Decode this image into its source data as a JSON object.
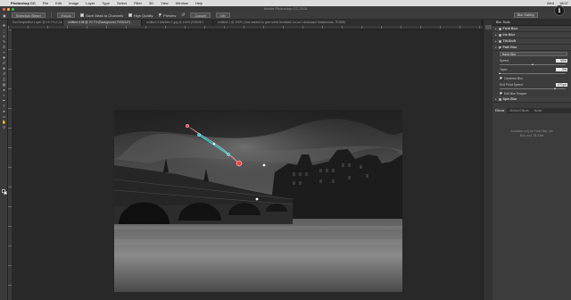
{
  "menubar": {
    "items": [
      "Photoshop CC",
      "File",
      "Edit",
      "Image",
      "Layer",
      "Type",
      "Select",
      "Filter",
      "3D",
      "View",
      "Window",
      "Help"
    ],
    "right": [
      "Wed",
      "18:07"
    ]
  },
  "titlebar": {
    "title": "Adobe Photoshop CC 2015"
  },
  "options": {
    "preset": "Selection Bleed",
    "focus": "Focus",
    "save_mask": "Save Mask to Channels",
    "high_quality": "High Quality",
    "preview": "Preview",
    "cancel": "Cancel",
    "ok": "OK"
  },
  "tabs": [
    {
      "label": "SunTempleBlur Layer @ 16.7% (Color/8#)",
      "active": false
    },
    {
      "label": "untitled-4.tiff @ 20.7% (Background, RGB/16*)",
      "active": true
    },
    {
      "label": "untitled-3 Marbles 1.jpg @ 100% (RGB/8*)",
      "active": false
    },
    {
      "label": "untitled-1 @ 100% (Just wanted to give some feedback on our Landscape Masterclass, RGB/8)",
      "active": false
    }
  ],
  "workspace_button": "Blur Gallery",
  "panel": {
    "tab": "Blur Tools",
    "sections": [
      {
        "name": "Field Blur",
        "checked": false
      },
      {
        "name": "Iris Blur",
        "checked": false
      },
      {
        "name": "Tilt-Shift",
        "checked": false
      },
      {
        "name": "Path Blur",
        "checked": true
      }
    ],
    "mode": "Basic Blur",
    "speed_label": "Speed:",
    "speed_value": "50%",
    "speed_level": 0.5,
    "taper_label": "Taper:",
    "taper_value": "0%",
    "taper_level": 0.0,
    "centered_label": "Centered Blur",
    "centered_checked": true,
    "endpoint_label": "End Point Speed:",
    "endpoint_value": "170 px",
    "endpoint_level": 0.85,
    "edit_shapes_label": "Edit Blur Shapes",
    "edit_shapes_checked": true,
    "spin": {
      "name": "Spin Blur",
      "checked": false
    },
    "lower_tabs": [
      "Effects",
      "Motion Effects",
      "Noise"
    ],
    "lower_message": "Available only for Field Blur, Iris Blur, and Tilt-Shift"
  },
  "icons": {
    "info": "info-icon",
    "tools": [
      "move-icon",
      "marquee-icon",
      "lasso-icon",
      "quick-select-icon",
      "crop-icon",
      "eyedropper-icon",
      "healing-icon",
      "brush-icon",
      "stamp-icon",
      "history-brush-icon",
      "eraser-icon",
      "gradient-icon",
      "blur-icon",
      "dodge-icon",
      "pen-icon",
      "type-icon",
      "path-select-icon",
      "rectangle-icon",
      "hand-icon",
      "zoom-icon"
    ]
  },
  "tool_glyphs": [
    "✥",
    "⬚",
    "ʘ",
    "✎",
    "⌗",
    "✑",
    "✚",
    "✐",
    "⎈",
    "↺",
    "◫",
    "▤",
    "●",
    "◐",
    "✒",
    "T",
    "➤",
    "▭",
    "✋",
    "⚲"
  ]
}
